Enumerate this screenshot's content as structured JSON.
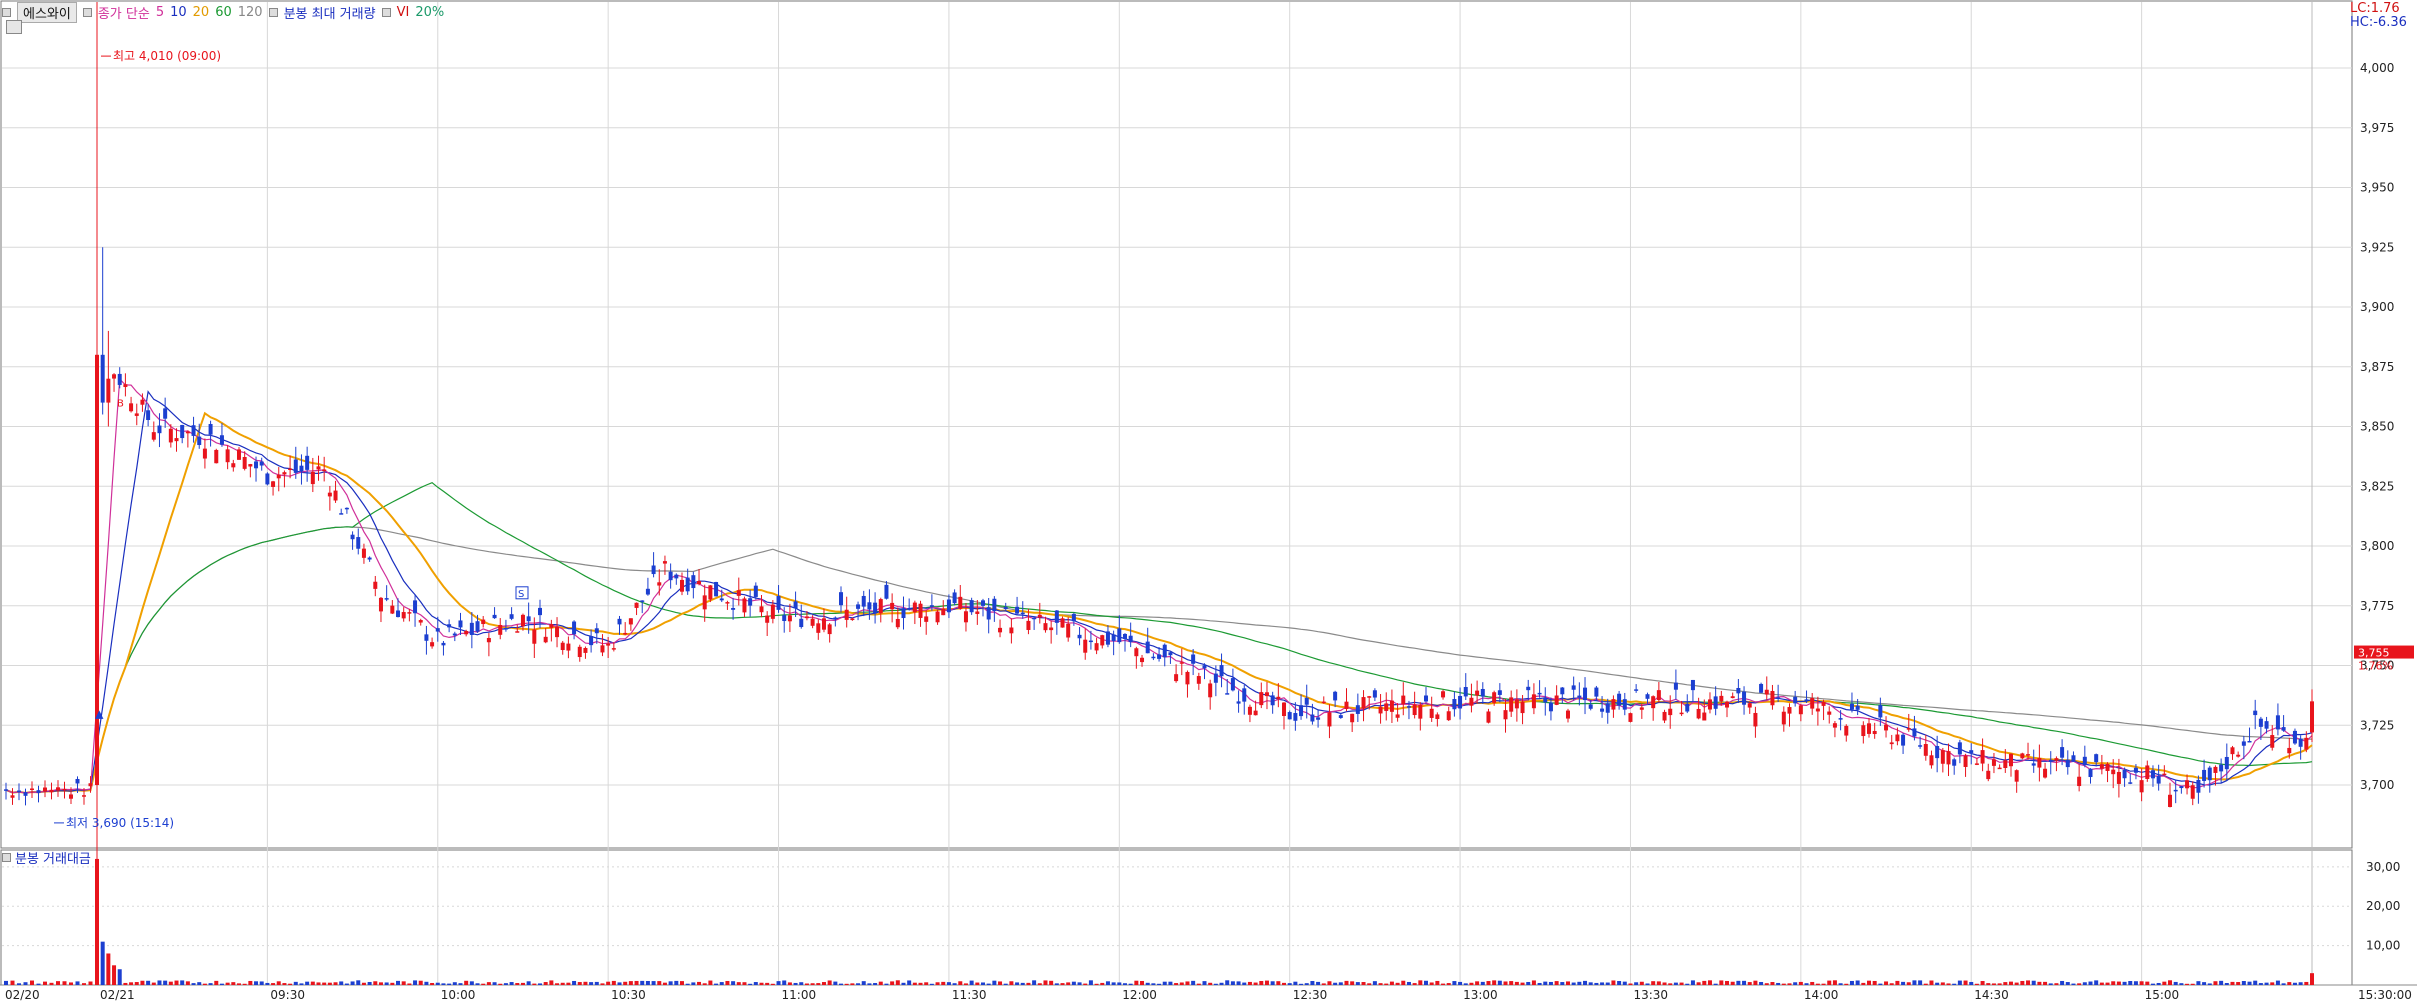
{
  "legend": {
    "stock_name": "에스와이",
    "ma_label": "종가 단순",
    "ma_periods": [
      "5",
      "10",
      "20",
      "60",
      "120"
    ],
    "volume_label": "분봉 최대 거래량",
    "vi_label": "VI",
    "vi_value": "20%"
  },
  "indicators": {
    "lc": "LC:1.76",
    "hc": "HC:-6.36"
  },
  "annotations": {
    "high": "최고 4,010 (09:00)",
    "low": "최저 3,690 (15:14)",
    "marker_b": "B",
    "marker_s": "S"
  },
  "current": {
    "price": "3,755",
    "change": "1.76%"
  },
  "volume_panel": {
    "title": "분봉 거래대금"
  },
  "colors": {
    "up": "#e8141c",
    "down": "#1c3fd0",
    "ma5": "#d0309a",
    "ma10": "#1a2fbf",
    "ma20": "#f0a000",
    "ma60": "#1c9a33",
    "ma120": "#8a8a8a",
    "grid": "#d8d8d8"
  },
  "chart_data": [
    {
      "type": "candlestick",
      "title": "에스와이",
      "x_ticks": [
        "02/20",
        "02/21",
        "09:30",
        "10:00",
        "10:30",
        "11:00",
        "11:30",
        "12:00",
        "12:30",
        "13:00",
        "13:30",
        "14:00",
        "14:30",
        "15:00",
        "15:30:00"
      ],
      "y_ticks": [
        "3,700",
        "3,725",
        "3,750",
        "3,775",
        "3,800",
        "3,825",
        "3,850",
        "3,875",
        "3,900",
        "3,925",
        "3,950",
        "3,975",
        "4,000"
      ],
      "ylim": [
        3675,
        4010
      ],
      "anchor_points": [
        {
          "x": "02/20 15:14",
          "y": 3690
        },
        {
          "x": "09:00",
          "y": 4010
        },
        {
          "x": "09:01",
          "y": 3880
        },
        {
          "x": "09:10",
          "y": 3850
        },
        {
          "x": "09:20",
          "y": 3845
        },
        {
          "x": "09:30",
          "y": 3830
        },
        {
          "x": "09:40",
          "y": 3832
        },
        {
          "x": "09:50",
          "y": 3780
        },
        {
          "x": "10:00",
          "y": 3760
        },
        {
          "x": "10:15",
          "y": 3770
        },
        {
          "x": "10:30",
          "y": 3758
        },
        {
          "x": "10:40",
          "y": 3790
        },
        {
          "x": "11:00",
          "y": 3770
        },
        {
          "x": "11:30",
          "y": 3775
        },
        {
          "x": "12:00",
          "y": 3760
        },
        {
          "x": "12:30",
          "y": 3730
        },
        {
          "x": "13:00",
          "y": 3735
        },
        {
          "x": "13:30",
          "y": 3735
        },
        {
          "x": "14:00",
          "y": 3735
        },
        {
          "x": "14:30",
          "y": 3710
        },
        {
          "x": "15:00",
          "y": 3705
        },
        {
          "x": "15:10",
          "y": 3695
        },
        {
          "x": "15:20",
          "y": 3725
        }
      ]
    },
    {
      "type": "bar",
      "title": "분봉 거래대금",
      "y_ticks": [
        "10,00",
        "20,00",
        "30,00"
      ],
      "ylim": [
        0,
        33
      ],
      "values_note": "",
      "spikes": [
        {
          "x": "09:00",
          "y": 32
        },
        {
          "x": "09:01",
          "y": 11
        },
        {
          "x": "09:02",
          "y": 8
        },
        {
          "x": "09:03",
          "y": 5
        },
        {
          "x": "09:04",
          "y": 4
        },
        {
          "x": "15:30",
          "y": 3
        }
      ]
    }
  ]
}
